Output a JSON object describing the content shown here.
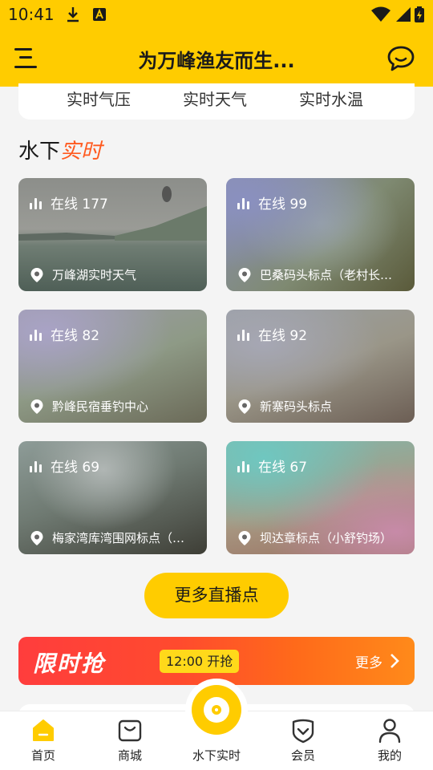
{
  "status_bar": {
    "time": "10:41"
  },
  "app_bar": {
    "title": "为万峰渔友而生..."
  },
  "weather_tabs": [
    "实时气压",
    "实时天气",
    "实时水温"
  ],
  "section": {
    "title_plain": "水下",
    "title_accent": "实时"
  },
  "cameras": [
    {
      "online": "在线 177",
      "location": "万峰湖实时天气"
    },
    {
      "online": "在线 99",
      "location": "巴桑码头标点（老村长野钓）"
    },
    {
      "online": "在线 82",
      "location": "黔峰民宿垂钓中心"
    },
    {
      "online": "在线 92",
      "location": "新寨码头标点"
    },
    {
      "online": "在线 69",
      "location": "梅家湾库湾围网标点（万峰）"
    },
    {
      "online": "在线 67",
      "location": "坝达章标点（小舒钓场）"
    }
  ],
  "more_button": "更多直播点",
  "flash_sale": {
    "title": "限时抢",
    "time": "12:00 开抢",
    "more": "更多"
  },
  "bottom_nav": [
    "首页",
    "商城",
    "水下实时",
    "会员",
    "我的"
  ],
  "colors": {
    "brand_yellow": "#ffcc00",
    "accent_orange": "#ff5a1f",
    "flash_red": "#ff3d3d"
  }
}
